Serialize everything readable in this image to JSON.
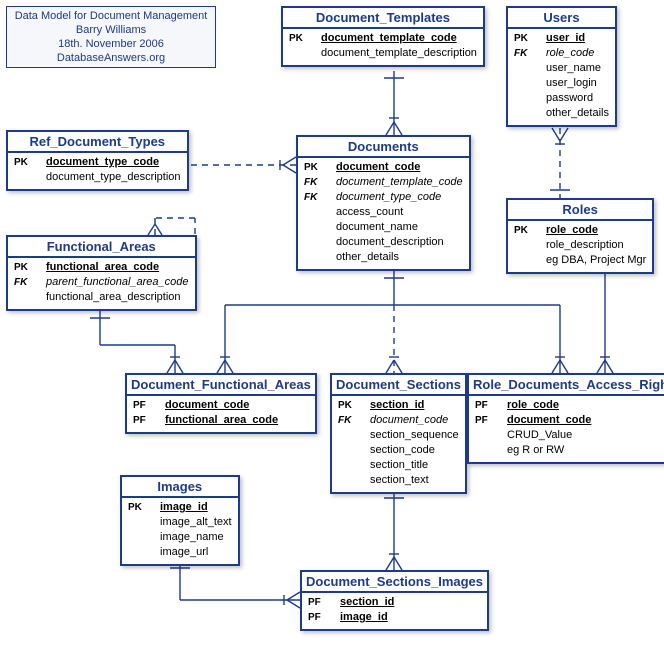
{
  "info": {
    "title": "Data Model for Document Management",
    "author": "Barry Williams",
    "date": "18th. November 2006",
    "source": "DatabaseAnswers.org"
  },
  "entities": {
    "document_templates": {
      "name": "Document_Templates",
      "fields": [
        {
          "key": "PK",
          "name": "document_template_code",
          "pk": true
        },
        {
          "key": "",
          "name": "document_template_description"
        }
      ]
    },
    "users": {
      "name": "Users",
      "fields": [
        {
          "key": "PK",
          "name": "user_id",
          "pk": true
        },
        {
          "key": "FK",
          "name": "role_code",
          "fk": true
        },
        {
          "key": "",
          "name": "user_name"
        },
        {
          "key": "",
          "name": "user_login"
        },
        {
          "key": "",
          "name": "password"
        },
        {
          "key": "",
          "name": "other_details"
        }
      ]
    },
    "ref_document_types": {
      "name": "Ref_Document_Types",
      "fields": [
        {
          "key": "PK",
          "name": "document_type_code",
          "pk": true
        },
        {
          "key": "",
          "name": "document_type_description"
        }
      ]
    },
    "documents": {
      "name": "Documents",
      "fields": [
        {
          "key": "PK",
          "name": "document_code",
          "pk": true
        },
        {
          "key": "FK",
          "name": "document_template_code",
          "fk": true
        },
        {
          "key": "FK",
          "name": "document_type_code",
          "fk": true
        },
        {
          "key": "",
          "name": "access_count"
        },
        {
          "key": "",
          "name": "document_name"
        },
        {
          "key": "",
          "name": "document_description"
        },
        {
          "key": "",
          "name": "other_details"
        }
      ]
    },
    "roles": {
      "name": "Roles",
      "fields": [
        {
          "key": "PK",
          "name": "role_code",
          "pk": true
        },
        {
          "key": "",
          "name": "role_description"
        },
        {
          "key": "",
          "name": "eg DBA, Project Mgr"
        }
      ]
    },
    "functional_areas": {
      "name": "Functional_Areas",
      "fields": [
        {
          "key": "PK",
          "name": "functional_area_code",
          "pk": true
        },
        {
          "key": "FK",
          "name": "parent_functional_area_code",
          "fk": true
        },
        {
          "key": "",
          "name": "functional_area_description"
        }
      ]
    },
    "document_functional_areas": {
      "name": "Document_Functional_Areas",
      "fields": [
        {
          "key": "PF",
          "name": "document_code",
          "pk": true
        },
        {
          "key": "PF",
          "name": "functional_area_code",
          "pk": true
        }
      ]
    },
    "document_sections": {
      "name": "Document_Sections",
      "fields": [
        {
          "key": "PK",
          "name": "section_id",
          "pk": true
        },
        {
          "key": "FK",
          "name": "document_code",
          "fk": true
        },
        {
          "key": "",
          "name": "section_sequence"
        },
        {
          "key": "",
          "name": "section_code"
        },
        {
          "key": "",
          "name": "section_title"
        },
        {
          "key": "",
          "name": "section_text"
        }
      ]
    },
    "role_documents_access_rights": {
      "name": "Role_Documents_Access_Rights",
      "fields": [
        {
          "key": "PF",
          "name": "role_code",
          "pk": true
        },
        {
          "key": "PF",
          "name": "document_code",
          "pk": true
        },
        {
          "key": "",
          "name": "CRUD_Value"
        },
        {
          "key": "",
          "name": "eg R or RW"
        }
      ]
    },
    "images": {
      "name": "Images",
      "fields": [
        {
          "key": "PK",
          "name": "image_id",
          "pk": true
        },
        {
          "key": "",
          "name": "image_alt_text"
        },
        {
          "key": "",
          "name": "image_name"
        },
        {
          "key": "",
          "name": "image_url"
        }
      ]
    },
    "document_sections_images": {
      "name": "Document_Sections_Images",
      "fields": [
        {
          "key": "PF",
          "name": "section_id",
          "pk": true
        },
        {
          "key": "PF",
          "name": "image_id",
          "pk": true
        }
      ]
    }
  }
}
